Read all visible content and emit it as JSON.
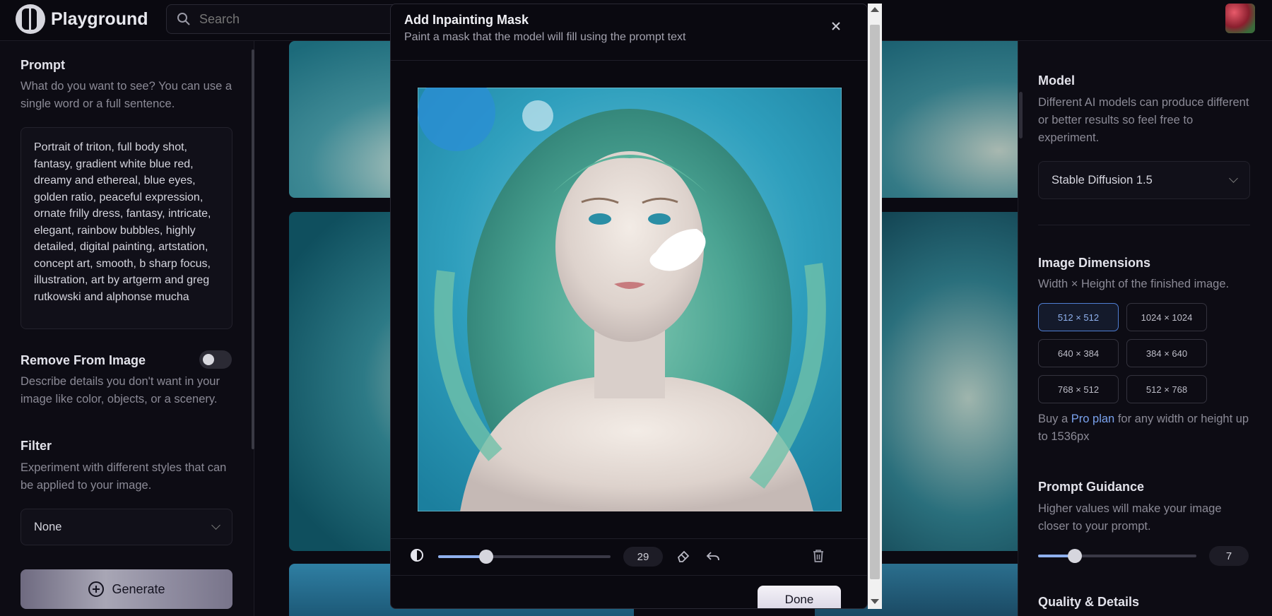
{
  "app": {
    "name": "Playground"
  },
  "search": {
    "placeholder": "Search"
  },
  "left": {
    "prompt_title": "Prompt",
    "prompt_sub": "What do you want to see? You can use a single word or a full sentence.",
    "prompt_text": "Portrait of triton, full body shot, fantasy, gradient white blue red, dreamy and ethereal, blue eyes, golden ratio, peaceful expression, ornate frilly dress, fantasy, intricate, elegant, rainbow bubbles, highly detailed, digital painting, artstation, concept art, smooth, b sharp focus, illustration, art by artgerm and greg rutkowski and alphonse mucha",
    "remove_title": "Remove From Image",
    "remove_sub": "Describe details you don't want in your image like color, objects, or a scenery.",
    "filter_title": "Filter",
    "filter_sub": "Experiment with different styles that can be applied to your image.",
    "filter_value": "None",
    "generate_label": "Generate"
  },
  "modal": {
    "title": "Add Inpainting Mask",
    "subtitle": "Paint a mask that the model will fill using the prompt text",
    "brush_size": "29",
    "brush_fraction": 0.28,
    "done_label": "Done"
  },
  "right": {
    "model_title": "Model",
    "model_sub": "Different AI models can produce different or better results so feel free to experiment.",
    "model_value": "Stable Diffusion 1.5",
    "dims_title": "Image Dimensions",
    "dims_sub": "Width × Height of the finished image.",
    "dims": [
      "512 × 512",
      "1024 × 1024",
      "640 × 384",
      "384 × 640",
      "768 × 512",
      "512 × 768"
    ],
    "selected_dim": "512 × 512",
    "pro_prefix": "Buy a ",
    "pro_link": "Pro plan",
    "pro_suffix": " for any width or height up to 1536px",
    "guidance_title": "Prompt Guidance",
    "guidance_sub": "Higher values will make your image closer to your prompt.",
    "guidance_value": "7",
    "quality_title": "Quality & Details"
  },
  "colors": {
    "accent": "#8fb0ee",
    "selected_border": "#4f7ed3",
    "background": "#0b0a12"
  }
}
